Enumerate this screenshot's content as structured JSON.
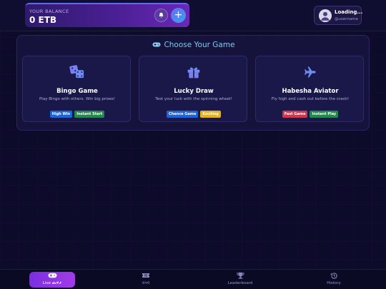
{
  "header": {
    "balance_label": "YOUR BALANCE",
    "balance_value": "0 ETB",
    "notification_icon": "bell-icon",
    "deposit_icon": "plus-icon",
    "user": {
      "name": "Loading...",
      "handle": "@username"
    }
  },
  "main": {
    "title": "Choose Your Game",
    "games": [
      {
        "title": "Bingo Game",
        "description": "Play Bingo with others. Win big prizes!",
        "icon": "dice-icon",
        "badges": [
          {
            "label": "High Win",
            "color": "#1d63d8"
          },
          {
            "label": "Instant Start",
            "color": "#1f8a4c"
          }
        ]
      },
      {
        "title": "Lucky Draw",
        "description": "Test your luck with the spinning wheel!",
        "icon": "gift-icon",
        "badges": [
          {
            "label": "Chance Game",
            "color": "#1d63d8"
          },
          {
            "label": "Exciting",
            "color": "#e3b21c"
          }
        ]
      },
      {
        "title": "Habesha Aviator",
        "description": "Fly high and cash out before the crash!",
        "icon": "plane-icon",
        "badges": [
          {
            "label": "Fast Game",
            "color": "#d2344a"
          },
          {
            "label": "Instant Play",
            "color": "#1f8a4c"
          }
        ]
      }
    ]
  },
  "bottom_nav": {
    "items": [
      {
        "label": "Live ጨዋታ",
        "icon": "gamepad-icon",
        "active": true
      },
      {
        "label": "ሂሳብ",
        "icon": "ticket-icon",
        "active": false
      },
      {
        "label": "Leaderboard",
        "icon": "trophy-icon",
        "active": false
      },
      {
        "label": "History",
        "icon": "history-icon",
        "active": false
      }
    ]
  },
  "colors": {
    "accent": "#7ec8ee",
    "balance_gradient_start": "#2e1a6e",
    "balance_gradient_end": "#6a28b8",
    "nav_active": "#8b34e4"
  }
}
